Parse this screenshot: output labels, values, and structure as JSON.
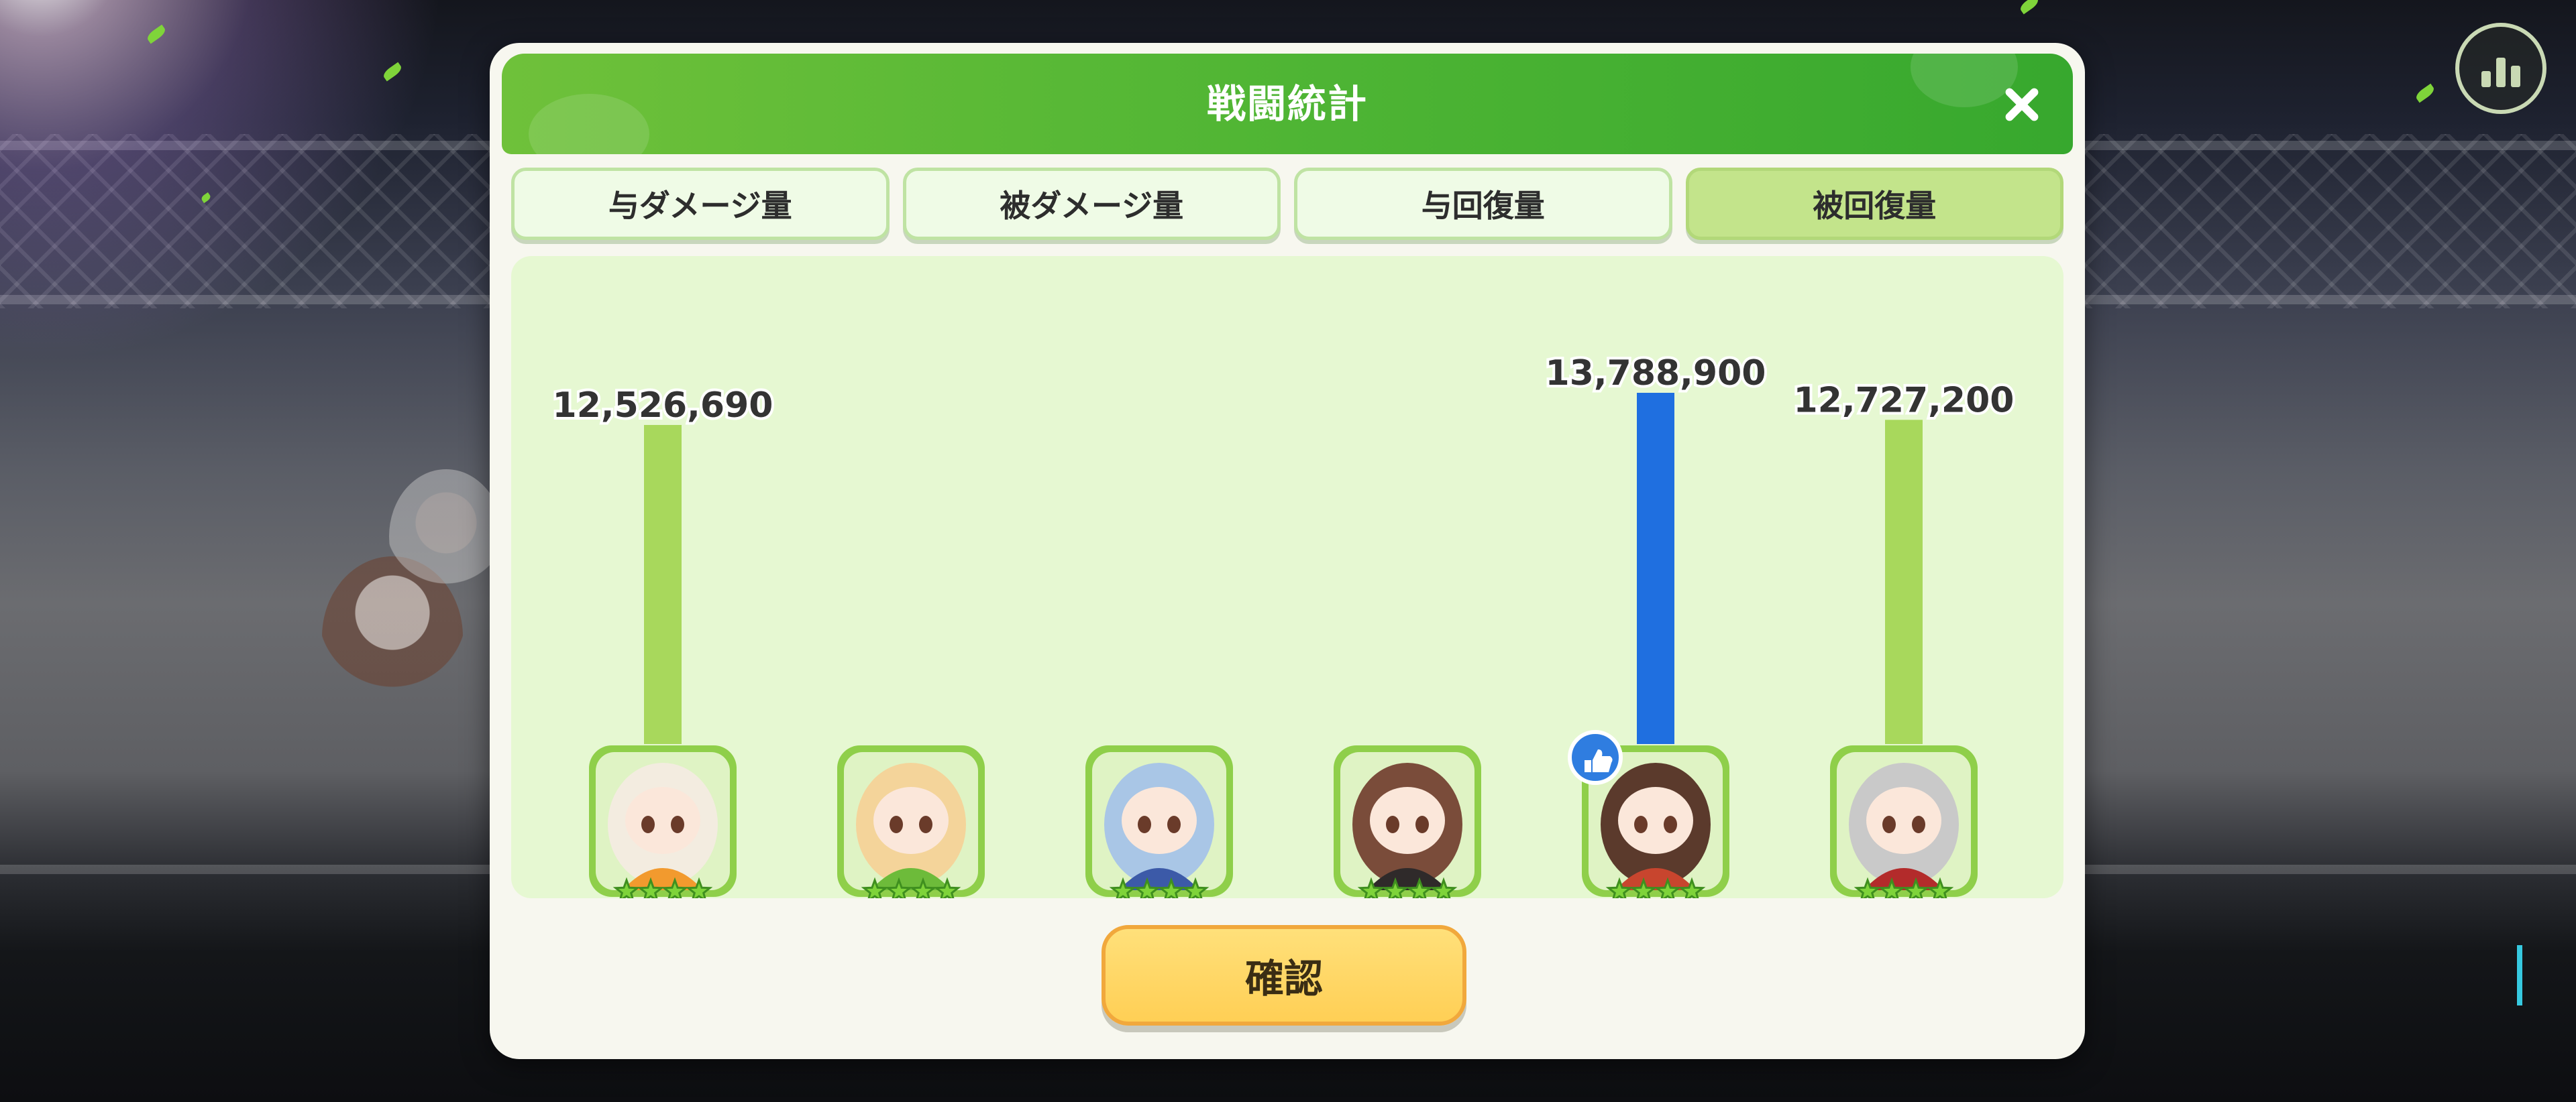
{
  "dialog": {
    "title": "戦闘統計",
    "tabs": [
      {
        "label": "与ダメージ量",
        "active": false
      },
      {
        "label": "被ダメージ量",
        "active": false
      },
      {
        "label": "与回復量",
        "active": false
      },
      {
        "label": "被回復量",
        "active": true
      }
    ],
    "confirm_label": "確認"
  },
  "colors": {
    "header_green": "#4fb534",
    "bar_default": "#a8d85c",
    "bar_highlight": "#1f6fe0",
    "panel_bg": "#e6f8d2",
    "confirm_yellow": "#ffd65c"
  },
  "chart_data": {
    "type": "bar",
    "categories": [
      "char-1",
      "char-2",
      "char-3",
      "char-4",
      "char-5",
      "char-6"
    ],
    "values": [
      12526690,
      0,
      0,
      0,
      13788900,
      12727200
    ],
    "value_labels": [
      "12,526,690",
      "",
      "",
      "",
      "13,788,900",
      "12,727,200"
    ],
    "highlight_index": 4,
    "ylim": [
      0,
      13788900
    ]
  },
  "characters": [
    {
      "hair": "#f3ece0",
      "accent": "#f29a2e",
      "stars": 4,
      "mvp": false
    },
    {
      "hair": "#f4d49a",
      "accent": "#6dbb3a",
      "stars": 4,
      "mvp": false
    },
    {
      "hair": "#a9c6e6",
      "accent": "#3c5aa8",
      "stars": 4,
      "mvp": false
    },
    {
      "hair": "#7a4c3a",
      "accent": "#2f2a2a",
      "stars": 4,
      "mvp": false
    },
    {
      "hair": "#5b3a2c",
      "accent": "#c8452e",
      "stars": 4,
      "mvp": true
    },
    {
      "hair": "#c9c9c9",
      "accent": "#b32b2b",
      "stars": 4,
      "mvp": false
    }
  ]
}
